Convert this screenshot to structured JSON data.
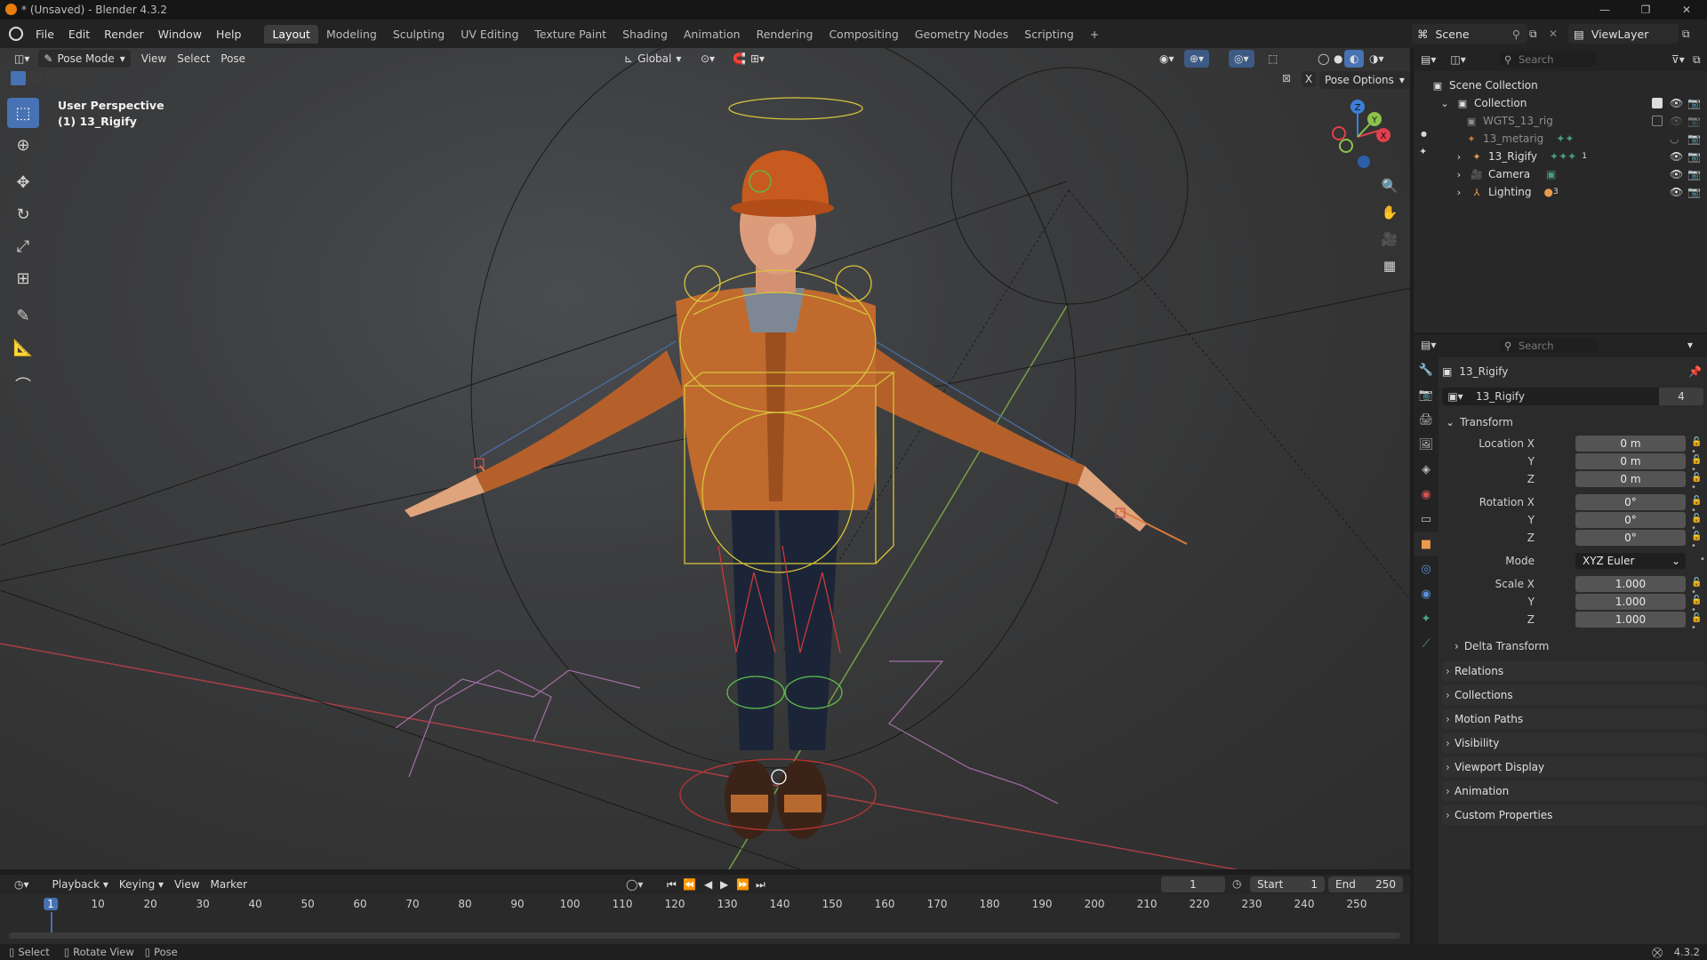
{
  "window": {
    "title": "* (Unsaved) - Blender 4.3.2"
  },
  "menu": [
    "File",
    "Edit",
    "Render",
    "Window",
    "Help"
  ],
  "workspaces": [
    "Layout",
    "Modeling",
    "Sculpting",
    "UV Editing",
    "Texture Paint",
    "Shading",
    "Animation",
    "Rendering",
    "Compositing",
    "Geometry Nodes",
    "Scripting"
  ],
  "active_workspace": "Layout",
  "scene": {
    "name": "Scene",
    "view_layer": "ViewLayer"
  },
  "viewport": {
    "mode": "Pose Mode",
    "menus": [
      "View",
      "Select",
      "Pose"
    ],
    "orientation": "Global",
    "info_line1": "User Perspective",
    "info_line2": "(1) 13_Rigify",
    "pose_options": "Pose Options",
    "close_x": "X"
  },
  "gizmo": {
    "x": "X",
    "y": "Y",
    "z": "Z"
  },
  "timeline": {
    "menus": [
      "Playback",
      "Keying",
      "View",
      "Marker"
    ],
    "current_frame": "1",
    "start_label": "Start",
    "start": "1",
    "end_label": "End",
    "end": "250",
    "ticks": [
      "1",
      "10",
      "20",
      "30",
      "40",
      "50",
      "60",
      "70",
      "80",
      "90",
      "100",
      "110",
      "120",
      "130",
      "140",
      "150",
      "160",
      "170",
      "180",
      "190",
      "200",
      "210",
      "220",
      "230",
      "240",
      "250"
    ]
  },
  "statusbar": {
    "select": "Select",
    "rotate": "Rotate View",
    "pose": "Pose",
    "version": "4.3.2"
  },
  "outliner": {
    "search_placeholder": "Search",
    "rows": [
      {
        "label": "Scene Collection"
      },
      {
        "label": "Collection"
      },
      {
        "label": "WGTS_13_rig"
      },
      {
        "label": "13_metarig"
      },
      {
        "label": "13_Rigify"
      },
      {
        "label": "Camera"
      },
      {
        "label": "Lighting"
      }
    ],
    "rigify_badge": "1",
    "lighting_badge": "3"
  },
  "properties": {
    "search_placeholder": "Search",
    "object_name": "13_Rigify",
    "datablock": "13_Rigify",
    "users": "4",
    "transform_label": "Transform",
    "location_label": "Location X",
    "rotation_label": "Rotation X",
    "scale_label": "Scale X",
    "axis_y": "Y",
    "axis_z": "Z",
    "location": [
      "0 m",
      "0 m",
      "0 m"
    ],
    "rotation": [
      "0°",
      "0°",
      "0°"
    ],
    "mode_label": "Mode",
    "rotation_mode": "XYZ Euler",
    "scale": [
      "1.000",
      "1.000",
      "1.000"
    ],
    "delta": "Delta Transform",
    "panels": [
      "Relations",
      "Collections",
      "Motion Paths",
      "Visibility",
      "Viewport Display",
      "Animation",
      "Custom Properties"
    ]
  },
  "colors": {
    "accent": "#4772b3",
    "object_orange": "#e99c4c",
    "axis_x": "#e0404c",
    "axis_y": "#8bc34a",
    "axis_z": "#3b7fd8"
  }
}
